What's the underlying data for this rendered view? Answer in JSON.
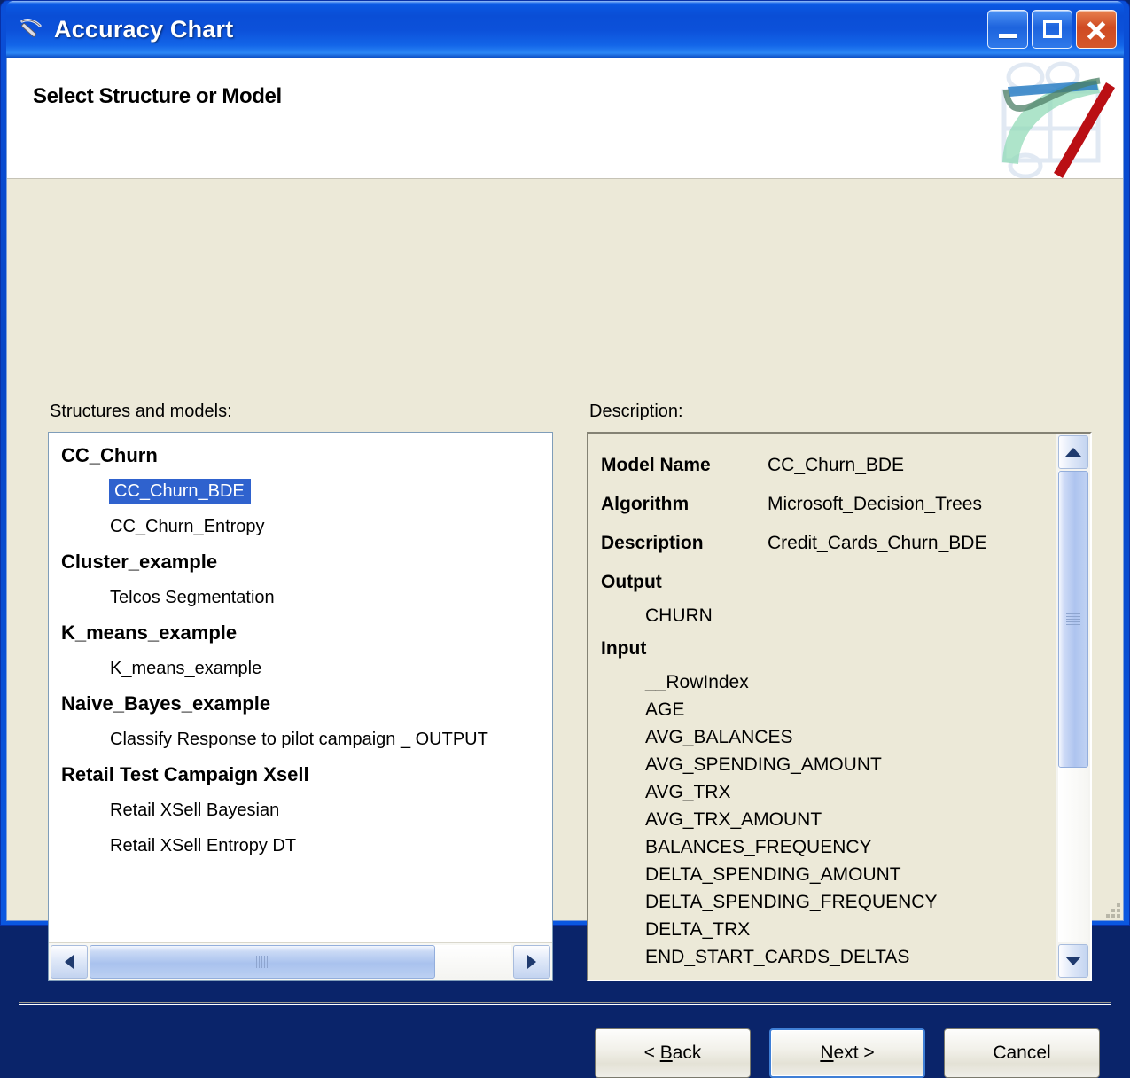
{
  "window": {
    "title": "Accuracy Chart",
    "app_icon": "pickaxe-icon",
    "minimize_label": "Minimize",
    "maximize_label": "Restore",
    "close_label": "Close",
    "accent_titlebar": "#0a4ed6",
    "accent_selection": "#2f62ce",
    "body_background": "#ece9d8"
  },
  "banner": {
    "title": "Select Structure or Model"
  },
  "left_panel": {
    "label": "Structures and models:",
    "items": [
      {
        "text": "CC_Churn",
        "type": "group",
        "selected": false
      },
      {
        "text": "CC_Churn_BDE",
        "type": "child",
        "selected": true
      },
      {
        "text": "CC_Churn_Entropy",
        "type": "child",
        "selected": false
      },
      {
        "text": "Cluster_example",
        "type": "group",
        "selected": false
      },
      {
        "text": "Telcos Segmentation",
        "type": "child",
        "selected": false
      },
      {
        "text": "K_means_example",
        "type": "group",
        "selected": false
      },
      {
        "text": "K_means_example",
        "type": "child",
        "selected": false
      },
      {
        "text": "Naive_Bayes_example",
        "type": "group",
        "selected": false
      },
      {
        "text": "Classify Response to pilot campaign _ OUTPUT",
        "type": "child",
        "selected": false
      },
      {
        "text": "Retail Test Campaign Xsell",
        "type": "group",
        "selected": false
      },
      {
        "text": "Retail XSell Bayesian",
        "type": "child",
        "selected": false
      },
      {
        "text": "Retail XSell Entropy DT",
        "type": "child",
        "selected": false
      }
    ],
    "hscroll": {
      "left_arrow": "scroll-left-icon",
      "right_arrow": "scroll-right-icon"
    }
  },
  "right_panel": {
    "label": "Description:",
    "rows": [
      {
        "key": "Model Name",
        "value": "CC_Churn_BDE"
      },
      {
        "key": "Algorithm",
        "value": "Microsoft_Decision_Trees"
      },
      {
        "key": "Description",
        "value": "Credit_Cards_Churn_BDE"
      }
    ],
    "output_section": "Output",
    "output_items": [
      "CHURN"
    ],
    "input_section": "Input",
    "input_items": [
      "__RowIndex",
      "AGE",
      "AVG_BALANCES",
      "AVG_SPENDING_AMOUNT",
      "AVG_TRX",
      "AVG_TRX_AMOUNT",
      "BALANCES_FREQUENCY",
      "DELTA_SPENDING_AMOUNT",
      "DELTA_SPENDING_FREQUENCY",
      "DELTA_TRX",
      "END_START_CARDS_DELTAS"
    ],
    "vscroll": {
      "up_arrow": "scroll-up-icon",
      "down_arrow": "scroll-down-icon"
    }
  },
  "footer": {
    "back_prefix": "< ",
    "back_accel": "B",
    "back_suffix": "ack",
    "next_accel": "N",
    "next_suffix": "ext >",
    "cancel_label": "Cancel"
  }
}
